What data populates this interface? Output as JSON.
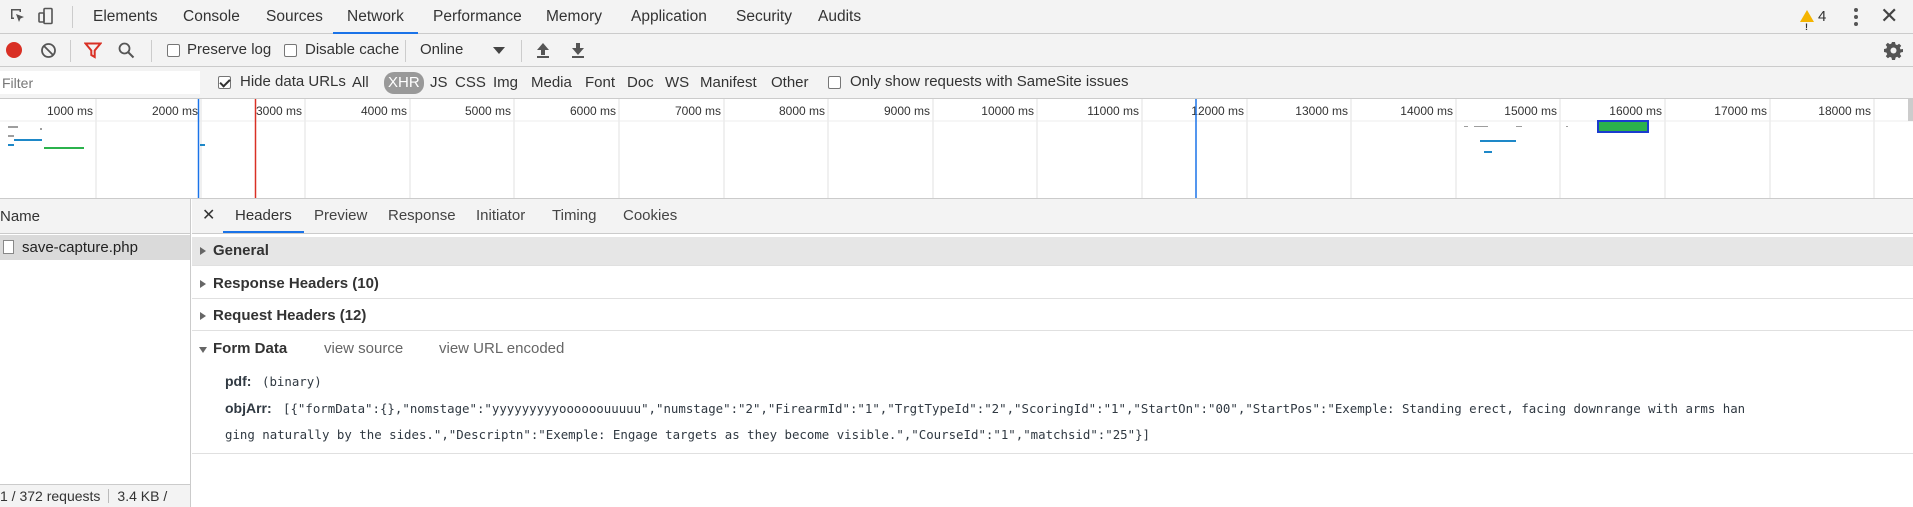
{
  "main_tabs": [
    "Elements",
    "Console",
    "Sources",
    "Network",
    "Performance",
    "Memory",
    "Application",
    "Security",
    "Audits"
  ],
  "active_main_tab": "Network",
  "warnings_count": "4",
  "toolbar": {
    "preserve_log_label": "Preserve log",
    "preserve_log_checked": false,
    "disable_cache_label": "Disable cache",
    "disable_cache_checked": false,
    "throttling_value": "Online"
  },
  "filter": {
    "placeholder": "Filter",
    "hide_data_urls_label": "Hide data URLs",
    "hide_data_urls_checked": true,
    "types": [
      "All",
      "XHR",
      "JS",
      "CSS",
      "Img",
      "Media",
      "Font",
      "Doc",
      "WS",
      "Manifest",
      "Other"
    ],
    "selected_type": "XHR",
    "samesite_label": "Only show requests with SameSite issues",
    "samesite_checked": false
  },
  "overview": {
    "ticks": [
      "1000 ms",
      "2000 ms",
      "3000 ms",
      "4000 ms",
      "5000 ms",
      "6000 ms",
      "7000 ms",
      "8000 ms",
      "9000 ms",
      "10000 ms",
      "11000 ms",
      "12000 ms",
      "13000 ms",
      "14000 ms",
      "15000 ms",
      "16000 ms",
      "17000 ms",
      "18000 ms"
    ]
  },
  "request_list": {
    "header": "Name",
    "rows": [
      "save-capture.php"
    ],
    "status_requests": "1 / 372 requests",
    "status_size": "3.4 KB /"
  },
  "detail": {
    "tabs": [
      "Headers",
      "Preview",
      "Response",
      "Initiator",
      "Timing",
      "Cookies"
    ],
    "active_tab": "Headers",
    "general_label": "General",
    "response_headers_label": "Response Headers (10)",
    "request_headers_label": "Request Headers (12)",
    "form_data_label": "Form Data",
    "view_source": "view source",
    "view_url_encoded": "view URL encoded",
    "form_fields": [
      {
        "key": "pdf:",
        "value": "(binary)"
      },
      {
        "key": "objArr:",
        "value": "[{\"formData\":{},\"nomstage\":\"yyyyyyyyyoooooouuuuu\",\"numstage\":\"2\",\"FirearmId\":\"1\",\"TrgtTypeId\":\"2\",\"ScoringId\":\"1\",\"StartOn\":\"00\",\"StartPos\":\"Exemple: Standing erect, facing downrange with arms han",
        "value_cont": "ging naturally by the sides.\",\"Descriptn\":\"Exemple: Engage targets as they become visible.\",\"CourseId\":\"1\",\"matchsid\":\"25\"}]"
      }
    ]
  }
}
